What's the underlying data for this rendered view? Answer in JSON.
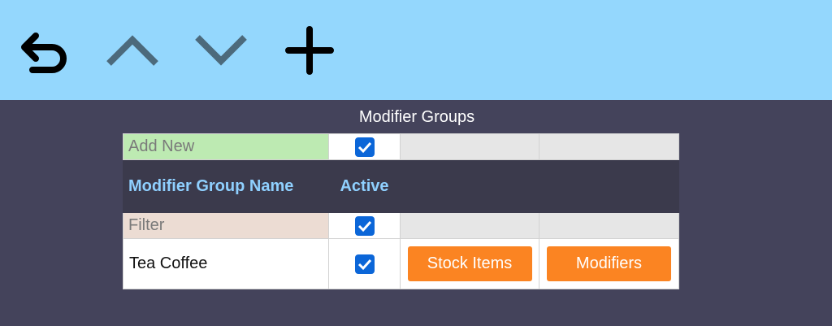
{
  "toolbar": {
    "buttons": [
      {
        "name": "back",
        "icon": "undo-arrow-icon",
        "color": "#000000"
      },
      {
        "name": "move-up",
        "icon": "chevron-up-icon",
        "color": "#4c6a7c"
      },
      {
        "name": "move-down",
        "icon": "chevron-down-icon",
        "color": "#4c6a7c"
      },
      {
        "name": "add",
        "icon": "plus-icon",
        "color": "#000000"
      }
    ]
  },
  "page": {
    "title": "Modifier Groups"
  },
  "grid": {
    "add_new_label": "Add New",
    "add_new_active": true,
    "columns": {
      "name": "Modifier Group Name",
      "active": "Active"
    },
    "filter_label": "Filter",
    "filter_active": true,
    "rows": [
      {
        "name": "Tea Coffee",
        "active": true,
        "stock_items_label": "Stock Items",
        "modifiers_label": "Modifiers"
      }
    ]
  },
  "colors": {
    "toolbar_bg": "#94d7fd",
    "page_bg": "#44435b",
    "header_bg": "#3b3a4c",
    "header_text": "#8fd0ff",
    "add_new_bg": "#bdeab2",
    "filter_bg": "#ecdcd3",
    "action_button": "#fb8422",
    "checkbox": "#0b66d8"
  }
}
